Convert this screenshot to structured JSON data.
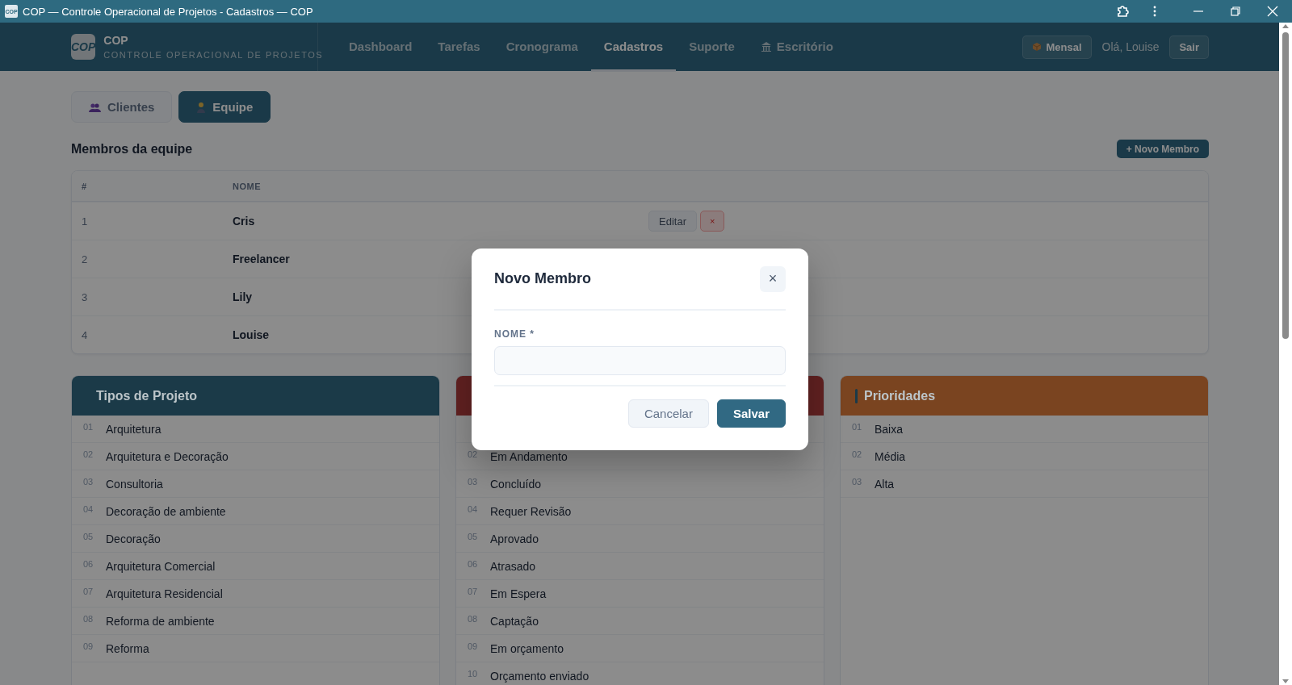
{
  "window": {
    "title": "COP — Controle Operacional de Projetos - Cadastros — COP",
    "logo": "COP"
  },
  "navbar": {
    "logo": "COP",
    "brand": "COP",
    "subtitle": "CONTROLE OPERACIONAL DE PROJETOS",
    "items": [
      {
        "label": "Dashboard",
        "selected": false,
        "kind": "plain"
      },
      {
        "label": "Tarefas",
        "selected": false,
        "kind": "plain"
      },
      {
        "label": "Cronograma",
        "selected": false,
        "kind": "plain"
      },
      {
        "label": "Cadastros",
        "selected": true,
        "kind": "plain"
      },
      {
        "label": "Suporte",
        "selected": false,
        "kind": "plain"
      },
      {
        "label": "Escritório",
        "selected": false,
        "kind": "icon"
      }
    ],
    "plan_button": "Mensal",
    "greeting": "Olá, Louise",
    "logout": "Sair"
  },
  "subtabs": [
    {
      "label": "Clientes",
      "selected": false
    },
    {
      "label": "Equipe",
      "selected": true
    }
  ],
  "section_title": "Membros da equipe",
  "add_button": "+ Novo Membro",
  "table": {
    "columns": [
      "#",
      "NOME"
    ],
    "rows": [
      {
        "number": "1",
        "name": "Cris",
        "actions": [
          "Editar",
          "×"
        ]
      },
      {
        "number": "2",
        "name": "Freelancer"
      },
      {
        "number": "3",
        "name": "Lily"
      },
      {
        "number": "4",
        "name": "Louise"
      }
    ]
  },
  "panels": [
    {
      "title": "Tipos de Projeto",
      "color": "#1b3a48",
      "marker": false,
      "covered_first_row": false,
      "items": [
        {
          "number": "01",
          "label": "Arquitetura"
        },
        {
          "number": "02",
          "label": "Arquitetura e Decoração"
        },
        {
          "number": "03",
          "label": "Consultoria"
        },
        {
          "number": "04",
          "label": "Decoração de ambiente"
        },
        {
          "number": "05",
          "label": "Decoração"
        },
        {
          "number": "06",
          "label": "Arquitetura Comercial"
        },
        {
          "number": "07",
          "label": "Arquitetura Residencial"
        },
        {
          "number": "08",
          "label": "Reforma de ambiente"
        },
        {
          "number": "09",
          "label": "Reforma"
        }
      ]
    },
    {
      "color": "#612121",
      "marker": false,
      "covered_first_row": true,
      "items": [
        {
          "number": "02",
          "label": "Em Andamento"
        },
        {
          "number": "03",
          "label": "Concluído"
        },
        {
          "number": "04",
          "label": "Requer Revisão"
        },
        {
          "number": "05",
          "label": "Aprovado"
        },
        {
          "number": "06",
          "label": "Atrasado"
        },
        {
          "number": "07",
          "label": "Em Espera"
        },
        {
          "number": "08",
          "label": "Captação"
        },
        {
          "number": "09",
          "label": "Em orçamento"
        },
        {
          "number": "10",
          "label": "Orçamento enviado"
        }
      ]
    },
    {
      "title": "Prioridades",
      "color": "#7a4420",
      "marker": true,
      "covered_first_row": false,
      "items": [
        {
          "number": "01",
          "label": "Baixa"
        },
        {
          "number": "02",
          "label": "Média"
        },
        {
          "number": "03",
          "label": "Alta"
        }
      ]
    }
  ],
  "dialog": {
    "title": "Novo Membro",
    "close": "×",
    "field_label": "NOME *",
    "buttons": [
      {
        "label": "Cancelar",
        "kind": "secondary"
      },
      {
        "label": "Salvar",
        "kind": "primary"
      }
    ]
  }
}
